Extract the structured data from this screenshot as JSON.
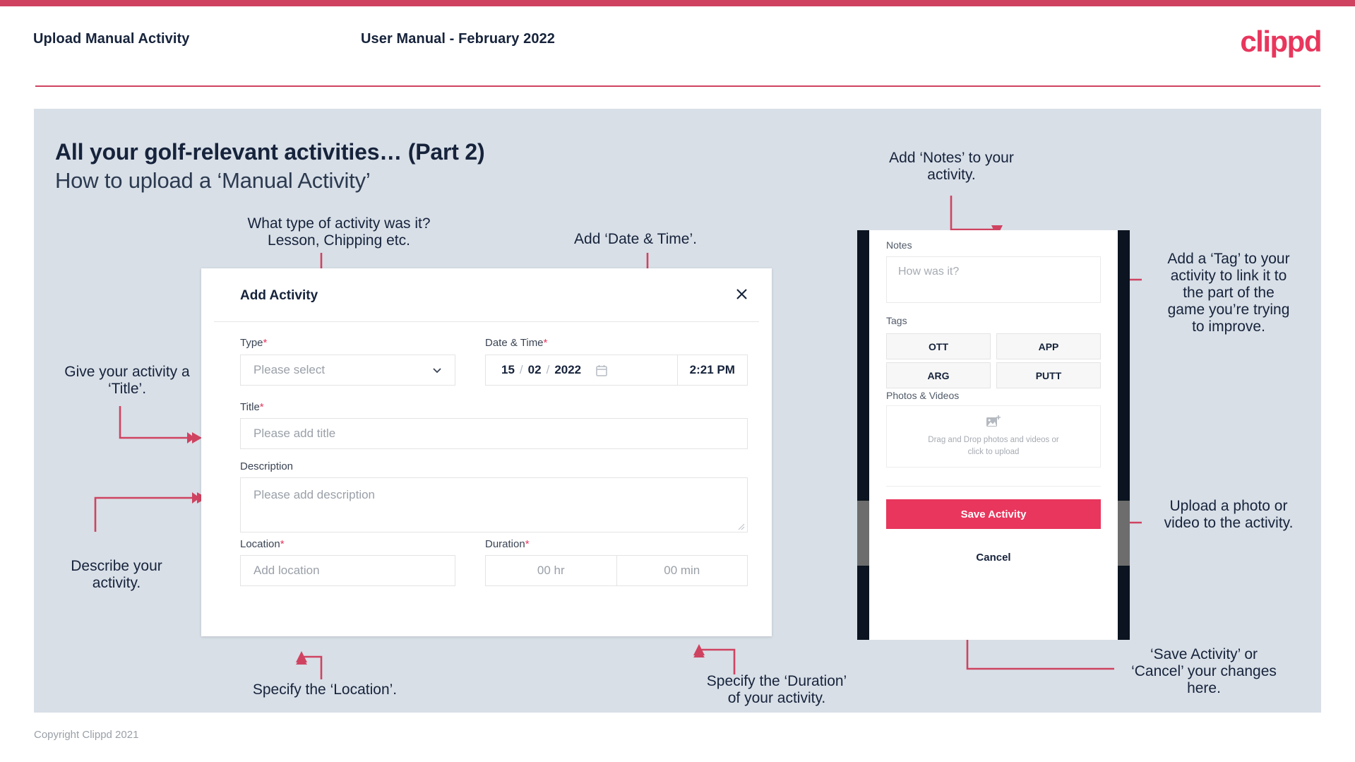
{
  "header": {
    "left_title": "Upload Manual Activity",
    "center_title": "User Manual - February 2022",
    "logo": "clippd"
  },
  "slide": {
    "title": "All your golf-relevant activities… (Part 2)",
    "subtitle": "How to upload a ‘Manual Activity’"
  },
  "dialog": {
    "title": "Add Activity",
    "close_icon": "close-icon",
    "fields": {
      "type": {
        "label": "Type",
        "required": "*",
        "placeholder": "Please select"
      },
      "datetime": {
        "label": "Date & Time",
        "required": "*",
        "day": "15",
        "month": "02",
        "year": "2022",
        "sep": "/",
        "time": "2:21 PM"
      },
      "title": {
        "label": "Title",
        "required": "*",
        "placeholder": "Please add title"
      },
      "description": {
        "label": "Description",
        "placeholder": "Please add description"
      },
      "location": {
        "label": "Location",
        "required": "*",
        "placeholder": "Add location"
      },
      "duration": {
        "label": "Duration",
        "required": "*",
        "hours": "00 hr",
        "minutes": "00 min"
      }
    }
  },
  "phone": {
    "notes_label": "Notes",
    "notes_placeholder": "How was it?",
    "tags_label": "Tags",
    "tags": [
      "OTT",
      "APP",
      "ARG",
      "PUTT"
    ],
    "photos_label": "Photos & Videos",
    "dropzone_text": "Drag and Drop photos and videos or\nclick to upload",
    "save_label": "Save Activity",
    "cancel_label": "Cancel"
  },
  "annotations": {
    "type": "What type of activity was it?\nLesson, Chipping etc.",
    "datetime": "Add ‘Date & Time’.",
    "title": "Give your activity a\n‘Title’.",
    "description": "Describe your\nactivity.",
    "location": "Specify the ‘Location’.",
    "duration": "Specify the ‘Duration’\nof your activity.",
    "notes": "Add ‘Notes’ to your\nactivity.",
    "tags": "Add a ‘Tag’ to your\nactivity to link it to\nthe part of the\ngame you’re trying\nto improve.",
    "upload": "Upload a photo or\nvideo to the activity.",
    "save": "‘Save Activity’ or\n‘Cancel’ your changes\nhere."
  },
  "footer": {
    "copyright": "Copyright Clippd 2021"
  },
  "colors": {
    "accent": "#e8365d",
    "rule": "#cf4361",
    "slide_bg": "#d8dfe7",
    "text": "#16233b"
  }
}
